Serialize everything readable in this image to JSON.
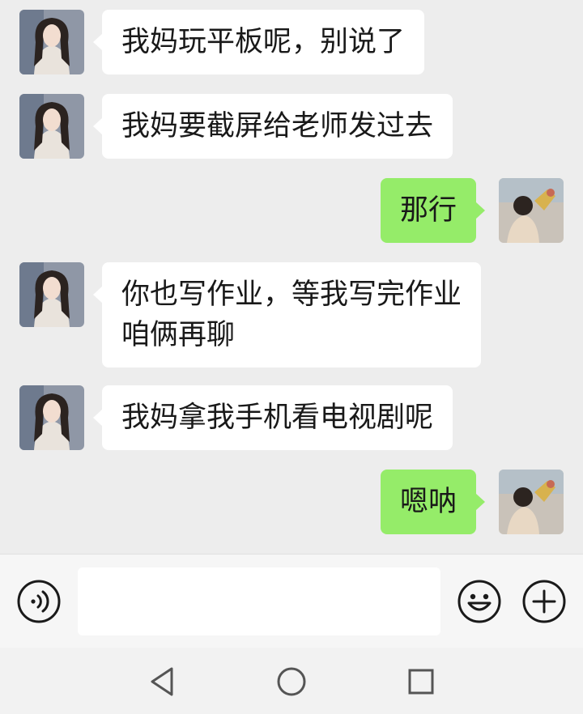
{
  "chat": {
    "messages": [
      {
        "side": "left",
        "lines": [
          "我妈玩平板呢，别说了"
        ]
      },
      {
        "side": "left",
        "lines": [
          "我妈要截屏给老师发过去"
        ]
      },
      {
        "side": "right",
        "lines": [
          "那行"
        ]
      },
      {
        "side": "left",
        "lines": [
          "你也写作业，等我写完作业",
          "咱俩再聊"
        ]
      },
      {
        "side": "left",
        "lines": [
          "我妈拿我手机看电视剧呢"
        ]
      },
      {
        "side": "right",
        "lines": [
          "嗯呐"
        ]
      }
    ]
  },
  "input_bar": {
    "message_value": "",
    "icons": {
      "voice": "voice-icon",
      "emoji": "emoji-icon",
      "more": "plus-icon"
    }
  },
  "nav_bar": {
    "icons": [
      "back-triangle-icon",
      "home-circle-icon",
      "recents-square-icon"
    ]
  },
  "colors": {
    "chat_background": "#ededed",
    "incoming_bubble": "#ffffff",
    "outgoing_bubble": "#95ec69",
    "text": "#191919",
    "input_bar_background": "#f6f6f6"
  }
}
